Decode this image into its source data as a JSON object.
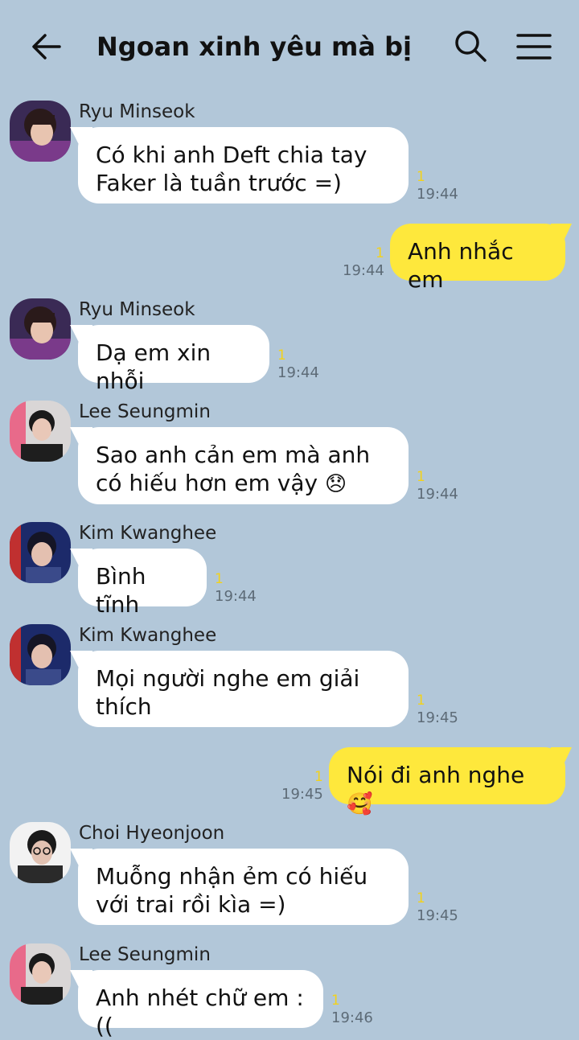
{
  "header": {
    "title": "Ngoan xinh yêu mà bị t..."
  },
  "colors": {
    "background": "#b2c7d9",
    "incoming_bubble": "#ffffff",
    "outgoing_bubble": "#fee83c",
    "unread_count": "#f3d21a"
  },
  "icons": {
    "back": "arrow-left-icon",
    "search": "search-icon",
    "menu": "hamburger-menu-icon"
  },
  "messages": [
    {
      "sender": "Ryu Minseok",
      "text": "Có khi anh Deft chia tay Faker là tuần trước =)",
      "unread": "1",
      "time": "19:44"
    },
    {
      "text": "Anh nhắc em",
      "unread": "1",
      "time": "19:44"
    },
    {
      "sender": "Ryu Minseok",
      "text": "Dạ em xin nhỗi",
      "unread": "1",
      "time": "19:44"
    },
    {
      "sender": "Lee Seungmin",
      "text": "Sao anh cản em mà anh có hiếu hơn em vậy",
      "emoji": "😞",
      "unread": "1",
      "time": "19:44"
    },
    {
      "sender": "Kim Kwanghee",
      "text": "Bình tĩnh",
      "unread": "1",
      "time": "19:44"
    },
    {
      "sender": "Kim Kwanghee",
      "text": "Mọi người nghe em giải thích",
      "unread": "1",
      "time": "19:45"
    },
    {
      "text": "Nói đi anh nghe",
      "emoji": "🥰",
      "unread": "1",
      "time": "19:45"
    },
    {
      "sender": "Choi Hyeonjoon",
      "text": "Muỗng nhận ẻm có hiếu với trai rồi kìa =)",
      "unread": "1",
      "time": "19:45"
    },
    {
      "sender": "Lee Seungmin",
      "text": "Anh nhét chữ em :((",
      "unread": "1",
      "time": "19:46"
    }
  ]
}
